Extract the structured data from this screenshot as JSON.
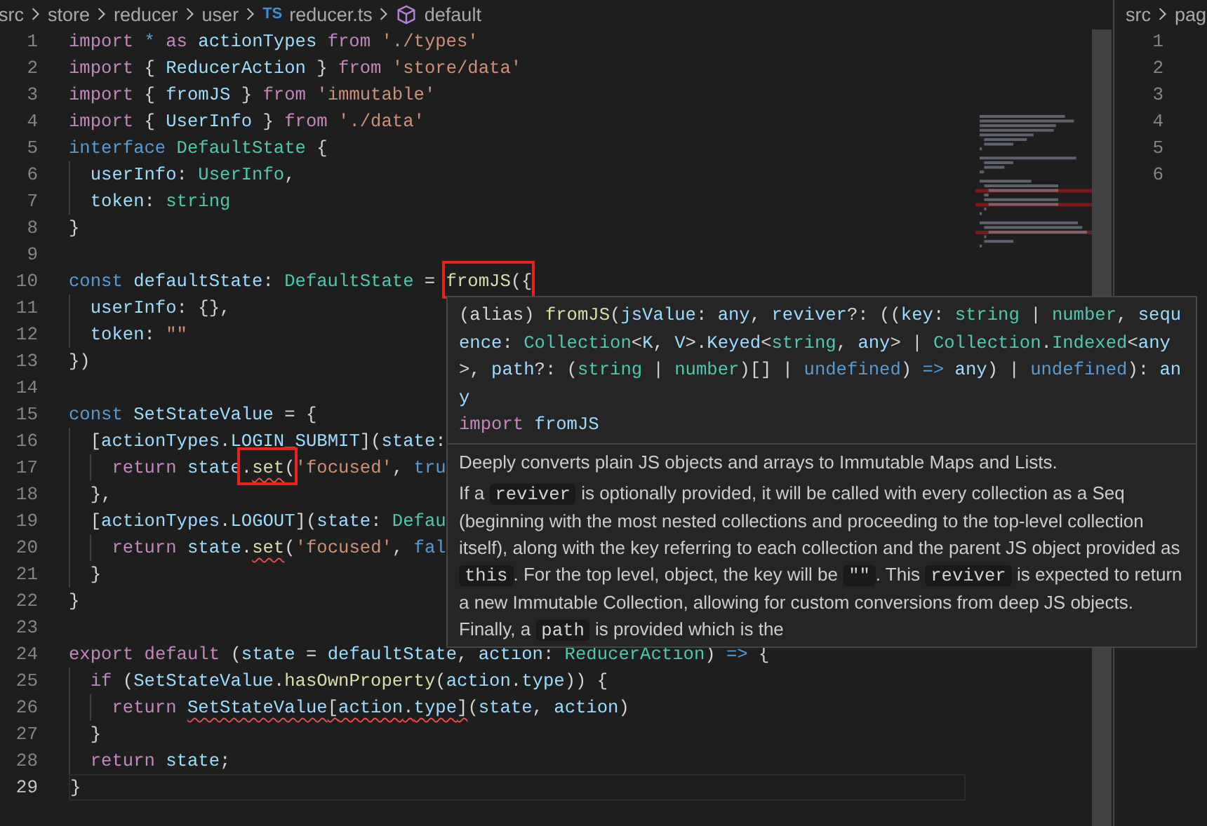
{
  "breadcrumb": [
    {
      "text": "src"
    },
    {
      "text": "store"
    },
    {
      "text": "reducer"
    },
    {
      "text": "user"
    },
    {
      "text": "reducer.ts",
      "kind": "file",
      "badge": "TS"
    },
    {
      "text": "default",
      "kind": "symbol"
    }
  ],
  "editor": {
    "lines": [
      {
        "number": "1",
        "tokens": [
          {
            "kind": "ctl",
            "text": "import "
          },
          {
            "kind": "kw",
            "text": "* "
          },
          {
            "kind": "ctl",
            "text": "as "
          },
          {
            "kind": "var",
            "text": "actionTypes "
          },
          {
            "kind": "ctl",
            "text": "from "
          },
          {
            "kind": "str",
            "text": "'./types'"
          }
        ]
      },
      {
        "number": "2",
        "tokens": [
          {
            "kind": "ctl",
            "text": "import "
          },
          {
            "kind": "plain",
            "text": "{ "
          },
          {
            "kind": "var",
            "text": "ReducerAction"
          },
          {
            "kind": "plain",
            "text": " } "
          },
          {
            "kind": "ctl",
            "text": "from "
          },
          {
            "kind": "str",
            "text": "'store/data'"
          }
        ]
      },
      {
        "number": "3",
        "tokens": [
          {
            "kind": "ctl",
            "text": "import "
          },
          {
            "kind": "plain",
            "text": "{ "
          },
          {
            "kind": "var",
            "text": "fromJS"
          },
          {
            "kind": "plain",
            "text": " } "
          },
          {
            "kind": "ctl",
            "text": "from "
          },
          {
            "kind": "str",
            "text": "'immutable'"
          }
        ]
      },
      {
        "number": "4",
        "tokens": [
          {
            "kind": "ctl",
            "text": "import "
          },
          {
            "kind": "plain",
            "text": "{ "
          },
          {
            "kind": "var",
            "text": "UserInfo"
          },
          {
            "kind": "plain",
            "text": " } "
          },
          {
            "kind": "ctl",
            "text": "from "
          },
          {
            "kind": "str",
            "text": "'./data'"
          }
        ]
      },
      {
        "number": "5",
        "tokens": [
          {
            "kind": "kw",
            "text": "interface "
          },
          {
            "kind": "type",
            "text": "DefaultState"
          },
          {
            "kind": "plain",
            "text": " {"
          }
        ]
      },
      {
        "number": "6",
        "tokens": [
          {
            "kind": "var",
            "text": "  userInfo"
          },
          {
            "kind": "plain",
            "text": ": "
          },
          {
            "kind": "type",
            "text": "UserInfo"
          },
          {
            "kind": "plain",
            "text": ","
          }
        ]
      },
      {
        "number": "7",
        "tokens": [
          {
            "kind": "var",
            "text": "  token"
          },
          {
            "kind": "plain",
            "text": ": "
          },
          {
            "kind": "type",
            "text": "string"
          }
        ]
      },
      {
        "number": "8",
        "tokens": [
          {
            "kind": "plain",
            "text": "}"
          }
        ]
      },
      {
        "number": "9"
      },
      {
        "number": "10",
        "tokens": [
          {
            "kind": "kw",
            "text": "const "
          },
          {
            "kind": "var",
            "text": "defaultState"
          },
          {
            "kind": "plain",
            "text": ": "
          },
          {
            "kind": "type",
            "text": "DefaultState"
          },
          {
            "kind": "plain",
            "text": " = "
          },
          {
            "kind": "fn",
            "text": "fromJS",
            "boxed": true
          },
          {
            "kind": "plain",
            "text": "({",
            "boxed": true
          }
        ]
      },
      {
        "number": "11",
        "tokens": [
          {
            "kind": "var",
            "text": "  userInfo"
          },
          {
            "kind": "plain",
            "text": ": {},"
          }
        ]
      },
      {
        "number": "12",
        "tokens": [
          {
            "kind": "var",
            "text": "  token"
          },
          {
            "kind": "plain",
            "text": ": "
          },
          {
            "kind": "str",
            "text": "\"\""
          }
        ]
      },
      {
        "number": "13",
        "tokens": [
          {
            "kind": "plain",
            "text": "})"
          }
        ]
      },
      {
        "number": "14"
      },
      {
        "number": "15",
        "tokens": [
          {
            "kind": "kw",
            "text": "const "
          },
          {
            "kind": "var",
            "text": "SetStateValue"
          },
          {
            "kind": "plain",
            "text": " = {"
          }
        ]
      },
      {
        "number": "16",
        "tokens": [
          {
            "kind": "plain",
            "text": "  ["
          },
          {
            "kind": "var",
            "text": "actionTypes"
          },
          {
            "kind": "plain",
            "text": "."
          },
          {
            "kind": "var",
            "text": "LOGIN_SUBMIT"
          },
          {
            "kind": "plain",
            "text": "]("
          },
          {
            "kind": "var",
            "text": "state"
          },
          {
            "kind": "plain",
            "text": ":"
          }
        ]
      },
      {
        "number": "17",
        "tokens": [
          {
            "kind": "ctl",
            "text": "    return "
          },
          {
            "kind": "var",
            "text": "state"
          },
          {
            "kind": "plain",
            "text": ".",
            "boxed": true
          },
          {
            "kind": "fn",
            "text": "set",
            "boxed": true,
            "squiggle": true
          },
          {
            "kind": "plain",
            "text": "(",
            "boxed": true
          },
          {
            "kind": "str",
            "text": "'focused'"
          },
          {
            "kind": "plain",
            "text": ", "
          },
          {
            "kind": "kw",
            "text": "tru"
          }
        ]
      },
      {
        "number": "18",
        "tokens": [
          {
            "kind": "plain",
            "text": "  },"
          }
        ]
      },
      {
        "number": "19",
        "tokens": [
          {
            "kind": "plain",
            "text": "  ["
          },
          {
            "kind": "var",
            "text": "actionTypes"
          },
          {
            "kind": "plain",
            "text": "."
          },
          {
            "kind": "var",
            "text": "LOGOUT"
          },
          {
            "kind": "plain",
            "text": "]("
          },
          {
            "kind": "var",
            "text": "state"
          },
          {
            "kind": "plain",
            "text": ": "
          },
          {
            "kind": "type",
            "text": "Defau"
          }
        ]
      },
      {
        "number": "20",
        "tokens": [
          {
            "kind": "ctl",
            "text": "    return "
          },
          {
            "kind": "var",
            "text": "state"
          },
          {
            "kind": "plain",
            "text": "."
          },
          {
            "kind": "fn",
            "text": "set",
            "squiggle": true
          },
          {
            "kind": "plain",
            "text": "("
          },
          {
            "kind": "str",
            "text": "'focused'"
          },
          {
            "kind": "plain",
            "text": ", "
          },
          {
            "kind": "kw",
            "text": "fal"
          }
        ]
      },
      {
        "number": "21",
        "tokens": [
          {
            "kind": "plain",
            "text": "  }"
          }
        ]
      },
      {
        "number": "22",
        "tokens": [
          {
            "kind": "plain",
            "text": "}"
          }
        ]
      },
      {
        "number": "23"
      },
      {
        "number": "24",
        "tokens": [
          {
            "kind": "ctl",
            "text": "export "
          },
          {
            "kind": "ctl",
            "text": "default "
          },
          {
            "kind": "plain",
            "text": "("
          },
          {
            "kind": "var",
            "text": "state"
          },
          {
            "kind": "plain",
            "text": " = "
          },
          {
            "kind": "var",
            "text": "defaultState"
          },
          {
            "kind": "plain",
            "text": ", "
          },
          {
            "kind": "var",
            "text": "action"
          },
          {
            "kind": "plain",
            "text": ": "
          },
          {
            "kind": "type",
            "text": "ReducerAction"
          },
          {
            "kind": "plain",
            "text": ") "
          },
          {
            "kind": "kw",
            "text": "=> "
          },
          {
            "kind": "plain",
            "text": "{"
          }
        ]
      },
      {
        "number": "25",
        "tokens": [
          {
            "kind": "ctl",
            "text": "  if "
          },
          {
            "kind": "plain",
            "text": "("
          },
          {
            "kind": "var",
            "text": "SetStateValue"
          },
          {
            "kind": "plain",
            "text": "."
          },
          {
            "kind": "fn",
            "text": "hasOwnProperty"
          },
          {
            "kind": "plain",
            "text": "("
          },
          {
            "kind": "var",
            "text": "action"
          },
          {
            "kind": "plain",
            "text": "."
          },
          {
            "kind": "var",
            "text": "type"
          },
          {
            "kind": "plain",
            "text": ")) {"
          }
        ]
      },
      {
        "number": "26",
        "tokens": [
          {
            "kind": "ctl",
            "text": "    return "
          },
          {
            "kind": "var",
            "text": "SetStateValue",
            "squiggle": true
          },
          {
            "kind": "plain",
            "text": "[",
            "squiggle": true
          },
          {
            "kind": "var",
            "text": "action",
            "squiggle": true
          },
          {
            "kind": "plain",
            "text": ".",
            "squiggle": true
          },
          {
            "kind": "var",
            "text": "type",
            "squiggle": true
          },
          {
            "kind": "plain",
            "text": "]",
            "squiggle": true
          },
          {
            "kind": "plain",
            "text": "("
          },
          {
            "kind": "var",
            "text": "state"
          },
          {
            "kind": "plain",
            "text": ", "
          },
          {
            "kind": "var",
            "text": "action"
          },
          {
            "kind": "plain",
            "text": ")"
          }
        ]
      },
      {
        "number": "27",
        "tokens": [
          {
            "kind": "plain",
            "text": "  }"
          }
        ]
      },
      {
        "number": "28",
        "tokens": [
          {
            "kind": "ctl",
            "text": "  return "
          },
          {
            "kind": "var",
            "text": "state"
          },
          {
            "kind": "plain",
            "text": ";"
          }
        ]
      },
      {
        "number": "29",
        "current": true,
        "tokens": [
          {
            "kind": "plain",
            "text": "}"
          }
        ]
      }
    ]
  },
  "hover": {
    "signature": [
      {
        "kind": "plain",
        "text": "(alias) "
      },
      {
        "kind": "fn",
        "text": "fromJS"
      },
      {
        "kind": "plain",
        "text": "("
      },
      {
        "kind": "var",
        "text": "jsValue"
      },
      {
        "kind": "plain",
        "text": ": "
      },
      {
        "kind": "var",
        "text": "any"
      },
      {
        "kind": "plain",
        "text": ", "
      },
      {
        "kind": "var",
        "text": "reviver"
      },
      {
        "kind": "plain",
        "text": "?: (("
      },
      {
        "kind": "var",
        "text": "key"
      },
      {
        "kind": "plain",
        "text": ": "
      },
      {
        "kind": "type",
        "text": "string"
      },
      {
        "kind": "plain",
        "text": " | "
      },
      {
        "kind": "type",
        "text": "number"
      },
      {
        "kind": "plain",
        "text": ", "
      },
      {
        "kind": "var",
        "text": "sequence"
      },
      {
        "kind": "plain",
        "text": ": "
      },
      {
        "kind": "type",
        "text": "Collection"
      },
      {
        "kind": "plain",
        "text": "<"
      },
      {
        "kind": "var",
        "text": "K"
      },
      {
        "kind": "plain",
        "text": ", "
      },
      {
        "kind": "var",
        "text": "V"
      },
      {
        "kind": "plain",
        "text": ">."
      },
      {
        "kind": "var",
        "text": "Keyed"
      },
      {
        "kind": "plain",
        "text": "<"
      },
      {
        "kind": "type",
        "text": "string"
      },
      {
        "kind": "plain",
        "text": ", "
      },
      {
        "kind": "var",
        "text": "any"
      },
      {
        "kind": "plain",
        "text": "> | "
      },
      {
        "kind": "type",
        "text": "Collection"
      },
      {
        "kind": "plain",
        "text": "."
      },
      {
        "kind": "type",
        "text": "Indexed"
      },
      {
        "kind": "plain",
        "text": "<"
      },
      {
        "kind": "var",
        "text": "any"
      },
      {
        "kind": "plain",
        "text": ">, "
      },
      {
        "kind": "var",
        "text": "path"
      },
      {
        "kind": "plain",
        "text": "?: ("
      },
      {
        "kind": "type",
        "text": "string"
      },
      {
        "kind": "plain",
        "text": " | "
      },
      {
        "kind": "type",
        "text": "number"
      },
      {
        "kind": "plain",
        "text": ")[] | "
      },
      {
        "kind": "kw",
        "text": "undefined"
      },
      {
        "kind": "plain",
        "text": ") "
      },
      {
        "kind": "kw",
        "text": "=> "
      },
      {
        "kind": "var",
        "text": "any"
      },
      {
        "kind": "plain",
        "text": ") | "
      },
      {
        "kind": "kw",
        "text": "undefined"
      },
      {
        "kind": "plain",
        "text": "): "
      },
      {
        "kind": "var",
        "text": "any"
      }
    ],
    "import_line": [
      {
        "kind": "ctl",
        "text": "import "
      },
      {
        "kind": "var",
        "text": "fromJS"
      }
    ],
    "paragraphs": [
      [
        {
          "text": "Deeply converts plain JS objects and arrays to Immutable Maps and Lists."
        }
      ],
      [
        {
          "text": "If a "
        },
        {
          "text": "reviver",
          "code": true
        },
        {
          "text": " is optionally provided, it will be called with every collection as a Seq (beginning with the most nested collections and proceeding to the top-level collection itself), along with the key referring to each collection and the parent JS object provided as "
        },
        {
          "text": "this",
          "code": true
        },
        {
          "text": ". For the top level, object, the key will be "
        },
        {
          "text": "\"\"",
          "code": true
        },
        {
          "text": ". This "
        },
        {
          "text": "reviver",
          "code": true
        },
        {
          "text": " is expected to return a new Immutable Collection, allowing for custom conversions from deep JS objects. Finally, a "
        },
        {
          "text": "path",
          "code": true
        },
        {
          "text": " is provided which is the"
        }
      ]
    ]
  },
  "side_editor": {
    "breadcrumb": [
      {
        "text": "src"
      },
      {
        "text": "pag"
      }
    ],
    "line_numbers": [
      "1",
      "2",
      "3",
      "4",
      "5",
      "6"
    ]
  }
}
